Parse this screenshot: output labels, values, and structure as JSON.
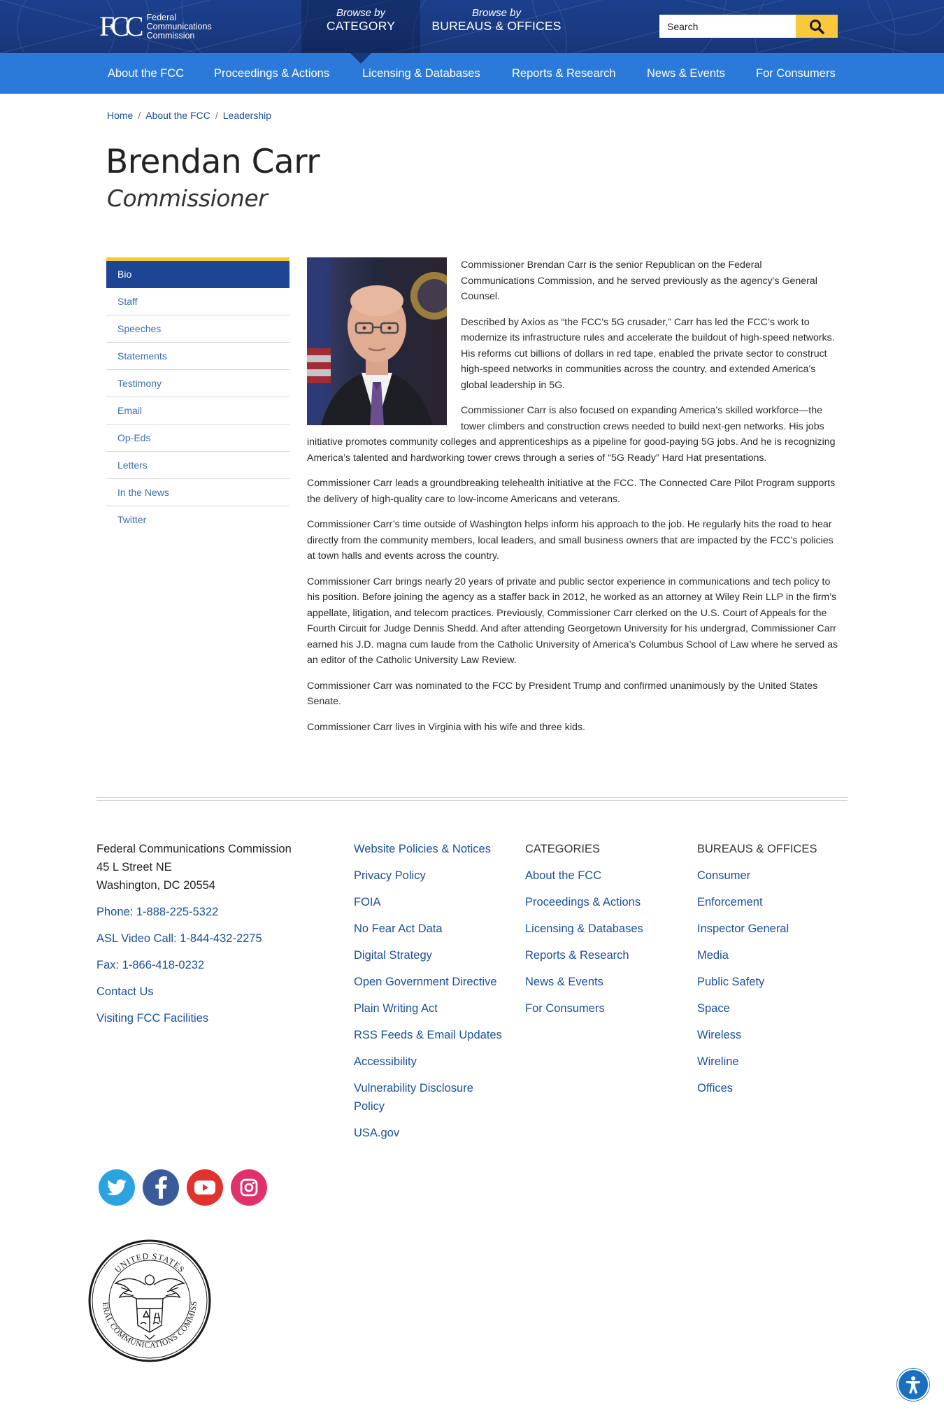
{
  "header": {
    "logo_text_1": "Federal",
    "logo_text_2": "Communications",
    "logo_text_3": "Commission",
    "browse_category_prefix": "Browse by",
    "browse_category_label": "CATEGORY",
    "browse_bureaus_prefix": "Browse by",
    "browse_bureaus_label": "BUREAUS & OFFICES",
    "search_placeholder": "Search"
  },
  "nav": {
    "items": [
      "About the FCC",
      "Proceedings & Actions",
      "Licensing & Databases",
      "Reports & Research",
      "News & Events",
      "For Consumers"
    ]
  },
  "breadcrumb": [
    "Home",
    "About the FCC",
    "Leadership"
  ],
  "page": {
    "title": "Brendan Carr",
    "subtitle": "Commissioner"
  },
  "sidebar": {
    "items": [
      "Bio",
      "Staff",
      "Speeches",
      "Statements",
      "Testimony",
      "Email",
      "Op-Eds",
      "Letters",
      "In the News",
      "Twitter"
    ]
  },
  "bio": {
    "paragraphs": [
      "Commissioner Brendan Carr is the senior Republican on the Federal Communications Commission, and he served previously as the agency’s General Counsel.",
      "Described by Axios as “the FCC’s 5G crusader,” Carr has led the FCC’s work to modernize its infrastructure rules and accelerate the buildout of high-speed networks. His reforms cut billions of dollars in red tape, enabled the private sector to construct high-speed networks in communities across the country, and extended America’s global leadership in 5G.",
      "Commissioner Carr is also focused on expanding America’s skilled workforce—the tower climbers and construction crews needed to build next-gen networks. His jobs initiative promotes community colleges and apprenticeships as a pipeline for good-paying 5G jobs. And he is recognizing America’s talented and hardworking tower crews through a series of “5G Ready” Hard Hat presentations.",
      "Commissioner Carr leads a groundbreaking telehealth initiative at the FCC. The Connected Care Pilot Program supports the delivery of high-quality care to low-income Americans and veterans.",
      "Commissioner Carr’s time outside of Washington helps inform his approach to the job. He regularly hits the road to hear directly from the community members, local leaders, and small business owners that are impacted by the FCC’s policies at town halls and events across the country.",
      "Commissioner Carr brings nearly 20 years of private and public sector experience in communications and tech policy to his position. Before joining the agency as a staffer back in 2012, he worked as an attorney at Wiley Rein LLP in the firm’s appellate, litigation, and telecom practices. Previously, Commissioner Carr clerked on the U.S. Court of Appeals for the Fourth Circuit for Judge Dennis Shedd. And after attending Georgetown University for his undergrad, Commissioner Carr earned his J.D. magna cum laude from the Catholic University of America’s Columbus School of Law where he served as an editor of the Catholic University Law Review.",
      "Commissioner Carr was nominated to the FCC by President Trump and confirmed unanimously by the United States Senate.",
      "Commissioner Carr lives in Virginia with his wife and three kids."
    ]
  },
  "footer": {
    "address_lines": [
      "Federal Communications Commission",
      "45 L Street NE",
      "Washington, DC 20554"
    ],
    "contact_links": [
      "Phone: 1-888-225-5322",
      "ASL Video Call: 1-844-432-2275",
      "Fax: 1-866-418-0232",
      "Contact Us",
      "Visiting FCC Facilities"
    ],
    "policy_links": [
      "Website Policies & Notices",
      "Privacy Policy",
      "FOIA",
      "No Fear Act Data",
      "Digital Strategy",
      "Open Government Directive",
      "Plain Writing Act",
      "RSS Feeds & Email Updates",
      "Accessibility",
      "Vulnerability Disclosure Policy",
      "USA.gov"
    ],
    "categories_heading": "CATEGORIES",
    "categories": [
      "About the FCC",
      "Proceedings & Actions",
      "Licensing & Databases",
      "Reports & Research",
      "News & Events",
      "For Consumers"
    ],
    "bureaus_heading": "BUREAUS & OFFICES",
    "bureaus": [
      "Consumer",
      "Enforcement",
      "Inspector General",
      "Media",
      "Public Safety",
      "Space",
      "Wireless",
      "Wireline",
      "Offices"
    ]
  },
  "seal": {
    "text_top": "UNITED STATES",
    "text_bottom": "FEDERAL COMMUNICATIONS COMMISSION"
  },
  "colors": {
    "header_blue": "#1b3f8c",
    "nav_blue": "#2b7ad9",
    "accent_yellow": "#f9c93b",
    "link_blue": "#1a4f9c",
    "sidebar_active": "#1d4593"
  },
  "icons": {
    "search": "search-icon",
    "twitter": "twitter-icon",
    "facebook": "facebook-icon",
    "youtube": "youtube-icon",
    "instagram": "instagram-icon",
    "accessibility": "accessibility-icon"
  }
}
